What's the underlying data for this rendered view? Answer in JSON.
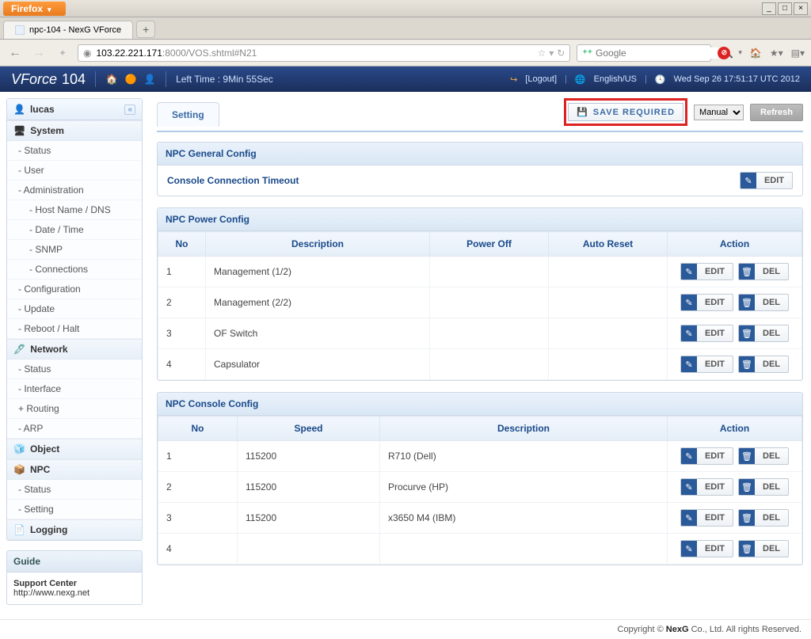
{
  "browser": {
    "menu_label": "Firefox",
    "tab_title": "npc-104 - NexG VForce",
    "url_host": "103.22.221.171",
    "url_path": ":8000/VOS.shtml#N21",
    "search_placeholder": "Google"
  },
  "banner": {
    "brand": "VForce",
    "model": "104",
    "left_time": "Left Time : 9Min 55Sec",
    "logout": "[Logout]",
    "lang": "English/US",
    "datetime": "Wed Sep 26 17:51:17 UTC 2012"
  },
  "sidebar": {
    "user": "lucas",
    "sections": {
      "system": "System",
      "network": "Network",
      "object": "Object",
      "npc": "NPC",
      "logging": "Logging"
    },
    "system_items": [
      "Status",
      "User",
      "Administration"
    ],
    "admin_sub": [
      "Host Name / DNS",
      "Date / Time",
      "SNMP",
      "Connections"
    ],
    "system_items2": [
      "Configuration",
      "Update",
      "Reboot / Halt"
    ],
    "network_items": [
      "Status",
      "Interface",
      "Routing",
      "ARP"
    ],
    "npc_items": [
      "Status",
      "Setting"
    ],
    "guide_title": "Guide",
    "support_title": "Support Center",
    "support_url": "http://www.nexg.net"
  },
  "content": {
    "tab": "Setting",
    "save_label": "SAVE REQUIRED",
    "mode": "Manual",
    "refresh": "Refresh",
    "general": {
      "title": "NPC General Config",
      "timeout_label": "Console Connection Timeout",
      "edit": "EDIT"
    },
    "power": {
      "title": "NPC Power Config",
      "headers": {
        "no": "No",
        "desc": "Description",
        "poff": "Power Off",
        "areset": "Auto Reset",
        "action": "Action"
      },
      "rows": [
        {
          "no": "1",
          "desc": "Management (1/2)",
          "poff": "",
          "areset": ""
        },
        {
          "no": "2",
          "desc": "Management (2/2)",
          "poff": "",
          "areset": ""
        },
        {
          "no": "3",
          "desc": "OF Switch",
          "poff": "",
          "areset": ""
        },
        {
          "no": "4",
          "desc": "Capsulator",
          "poff": "",
          "areset": ""
        }
      ]
    },
    "console": {
      "title": "NPC Console Config",
      "headers": {
        "no": "No",
        "speed": "Speed",
        "desc": "Description",
        "action": "Action"
      },
      "rows": [
        {
          "no": "1",
          "speed": "115200",
          "desc": "R710 (Dell)"
        },
        {
          "no": "2",
          "speed": "115200",
          "desc": "Procurve (HP)"
        },
        {
          "no": "3",
          "speed": "115200",
          "desc": "x3650 M4 (IBM)"
        },
        {
          "no": "4",
          "speed": "",
          "desc": ""
        }
      ]
    },
    "action_labels": {
      "edit": "EDIT",
      "del": "DEL"
    }
  },
  "footer": {
    "text_prefix": "Copyright © ",
    "brand": "NexG",
    "text_suffix": " Co., Ltd. All rights Reserved."
  }
}
